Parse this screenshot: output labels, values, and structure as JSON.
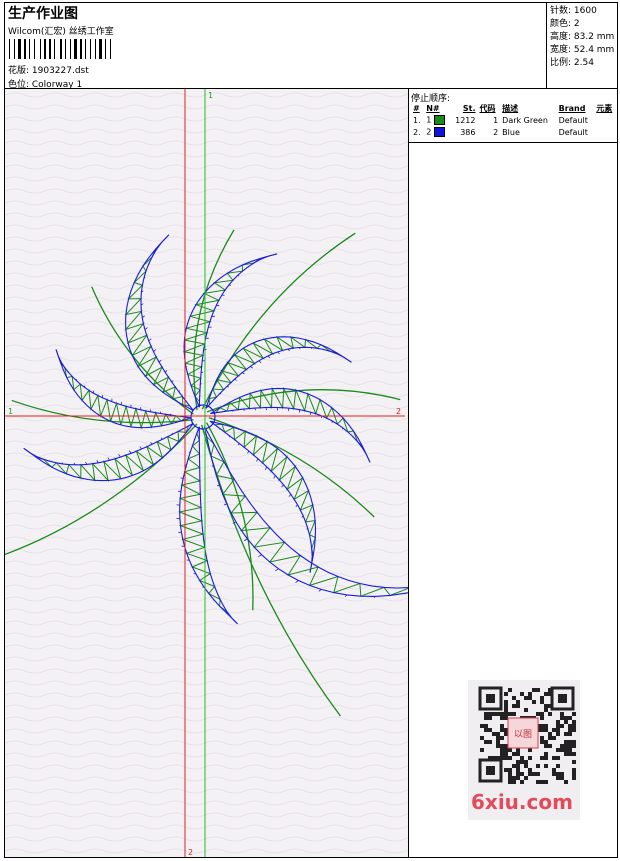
{
  "header": {
    "title": "生产作业图",
    "subtitle": "Wilcom(汇宏) 丝绣工作室",
    "design_label": "花版:   1903227.dst",
    "color_label": "色位:   Colorway 1"
  },
  "stats": {
    "stitches": "针数:  1600",
    "colors": "颜色:  2",
    "height": "高度:  83.2 mm",
    "width": "宽度:  52.4 mm",
    "scale": "比例:  2.54"
  },
  "stop_sequence": {
    "heading": "停止顺序:",
    "columns": [
      "#",
      "N#",
      "St.",
      "代码",
      "描述",
      "Brand",
      "元素"
    ],
    "rows": [
      {
        "idx": "1.",
        "n": "1",
        "color": "#1a8a1a",
        "st": "1212",
        "code": "1",
        "desc": "Dark Green",
        "brand": "Default"
      },
      {
        "idx": "2.",
        "n": "2",
        "color": "#1010e0",
        "st": "386",
        "code": "2",
        "desc": "Blue",
        "brand": "Default"
      }
    ]
  },
  "axes": {
    "v1": "1",
    "v2": "2",
    "h1": "1",
    "h2": "2"
  },
  "colors": {
    "green": "#1a8a1a",
    "blue": "#1a1ae0",
    "red_axis": "#e02020",
    "green_axis": "#20c020"
  },
  "watermark": {
    "text": "6xiu.com",
    "seal": "以图"
  }
}
